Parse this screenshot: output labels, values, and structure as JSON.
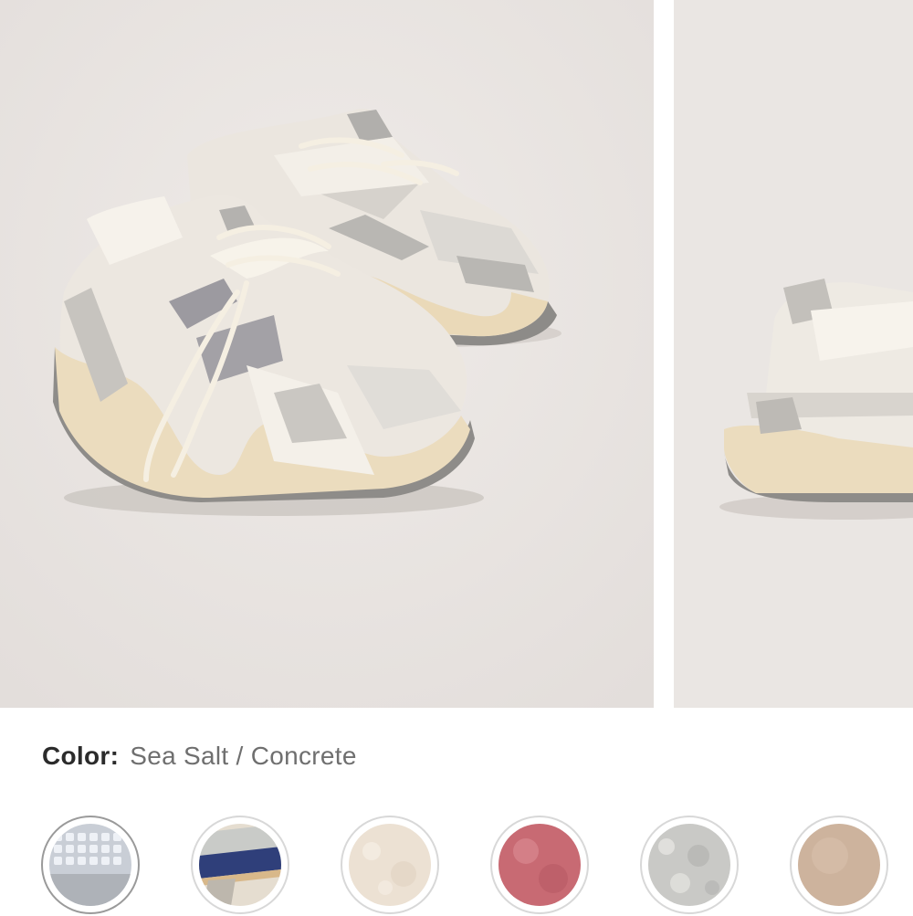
{
  "gallery": {
    "images": [
      {
        "alt": "Sea Salt / Concrete sneakers pair",
        "icon": "sneaker-pair-image"
      },
      {
        "alt": "Sea Salt / Concrete sneaker heel",
        "icon": "sneaker-heel-image"
      }
    ]
  },
  "color": {
    "label": "Color:",
    "value": "Sea Salt / Concrete"
  },
  "swatches": [
    {
      "name": "swatch-1",
      "color": "#c9ced6",
      "accent": "#eef1f6"
    },
    {
      "name": "swatch-2",
      "color": "#e5ddd0",
      "accent": "#2f3f7a"
    },
    {
      "name": "swatch-3",
      "color": "#ece1d3",
      "accent": "#f6efe6"
    },
    {
      "name": "swatch-4",
      "color": "#c86a73",
      "accent": "#dc8d95"
    },
    {
      "name": "swatch-5",
      "color": "#c9c9c6",
      "accent": "#e6e5e1"
    },
    {
      "name": "swatch-6",
      "color": "#cdb39d",
      "accent": "#dbc4af"
    }
  ],
  "colors": {
    "background": "#ffffff",
    "photo_bg": "#e9e5e2",
    "label_text": "#2b2b2b",
    "value_text": "#6f6f6f"
  }
}
